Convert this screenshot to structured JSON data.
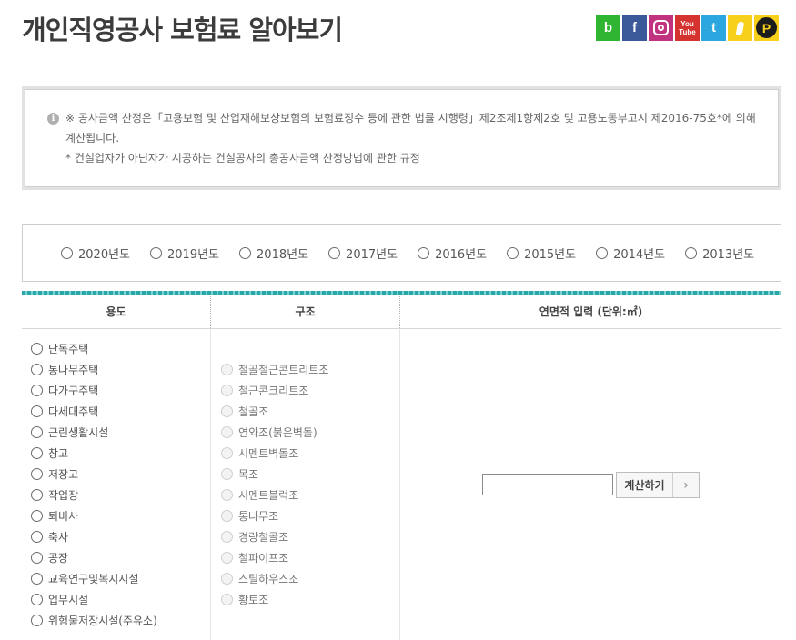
{
  "page": {
    "title": "개인직영공사 보험료 알아보기"
  },
  "sns": {
    "band_label": "b",
    "facebook_label": "f",
    "youtube_top": "You",
    "youtube_bottom": "Tube",
    "twitter_label": "t",
    "kakaopage_label": "P"
  },
  "notice": {
    "info_glyph": "i",
    "line1": "※ 공사금액 산정은「고용보험 및 산업재해보상보험의 보험료징수 등에 관한 법률 시행령」제2조제1항제2호 및 고용노동부고시 제2016-75호*에 의해",
    "line2": "계산됩니다.",
    "line3": "* 건설업자가 아닌자가 시공하는 건설공사의 총공사금액 산정방법에 관한 규정"
  },
  "years": [
    "2020년도",
    "2019년도",
    "2018년도",
    "2017년도",
    "2016년도",
    "2015년도",
    "2014년도",
    "2013년도"
  ],
  "table": {
    "header_usage": "용도",
    "header_structure": "구조",
    "header_area": "연면적 입력 (단위:㎡)"
  },
  "usage_options": [
    "단독주택",
    "통나무주택",
    "다가구주택",
    "다세대주택",
    "근린생활시설",
    "창고",
    "저장고",
    "작업장",
    "퇴비사",
    "축사",
    "공장",
    "교육연구및복지시설",
    "업무시설",
    "위험물저장시설(주유소)"
  ],
  "structure_options": [
    "철골철근콘트리트조",
    "철근콘크리트조",
    "철골조",
    "연와조(붉은벽돌)",
    "시멘트벽돌조",
    "목조",
    "시멘트블럭조",
    "통나무조",
    "경량철골조",
    "철파이프조",
    "스틸하우스조",
    "황토조"
  ],
  "calc": {
    "input_value": "",
    "button_label": "계산하기",
    "arrow": "›"
  },
  "colors": {
    "accent_teal": "#27a7a9",
    "band": "#2fb531",
    "facebook": "#3b5998",
    "instagram": "#c2337f",
    "youtube": "#d5332f",
    "twitter": "#2ba6de",
    "kakao": "#f7d01c"
  }
}
